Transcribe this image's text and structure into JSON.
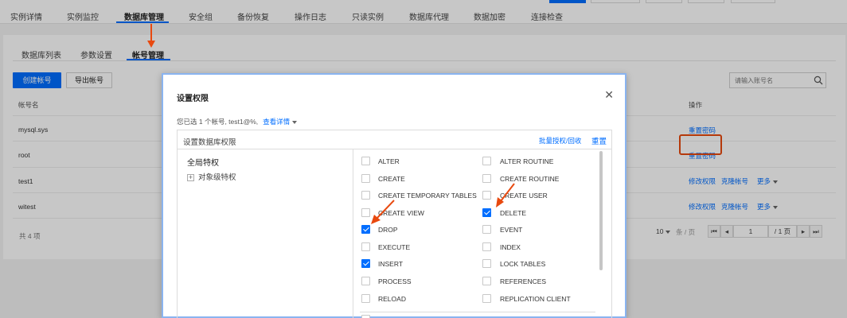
{
  "top_tabs": [
    "实例详情",
    "实例监控",
    "数据库管理",
    "安全组",
    "备份恢复",
    "操作日志",
    "只读实例",
    "数据库代理",
    "数据加密",
    "连接检查"
  ],
  "top_active_index": 2,
  "sub_tabs": [
    "数据库列表",
    "参数设置",
    "帐号管理"
  ],
  "sub_active_index": 2,
  "toolbar": {
    "create_label": "创建帐号",
    "export_label": "导出帐号",
    "search_placeholder": "请输入账号名"
  },
  "table": {
    "col_account": "帐号名",
    "col_actions": "操作",
    "rows": [
      {
        "name": "mysql.sys",
        "actions": [
          "重置密码"
        ]
      },
      {
        "name": "root",
        "actions": [
          "重置密码"
        ]
      },
      {
        "name": "test1",
        "actions": [
          "修改权限",
          "克隆帐号",
          "更多"
        ]
      },
      {
        "name": "witest",
        "actions": [
          "修改权限",
          "克隆帐号",
          "更多"
        ]
      }
    ],
    "total": "共 4 项"
  },
  "pagination": {
    "page_size": "10",
    "per_page_unit": "条 / 页",
    "current_page": "1",
    "total_pages": "/ 1 页"
  },
  "modal": {
    "title": "设置权限",
    "selected_info": "您已选 1 个帐号, test1@%,",
    "view_detail": "查看详情",
    "perm_box_title": "设置数据库权限",
    "batch_action": "批量授权/回收",
    "reset": "重置",
    "global_priv": "全局特权",
    "object_priv": "对象级特权",
    "privileges_left": [
      {
        "label": "ALTER",
        "checked": false
      },
      {
        "label": "CREATE",
        "checked": false
      },
      {
        "label": "CREATE TEMPORARY TABLES",
        "checked": false
      },
      {
        "label": "CREATE VIEW",
        "checked": false
      },
      {
        "label": "DROP",
        "checked": true
      },
      {
        "label": "EXECUTE",
        "checked": false
      },
      {
        "label": "INSERT",
        "checked": true
      },
      {
        "label": "PROCESS",
        "checked": false
      },
      {
        "label": "RELOAD",
        "checked": false
      }
    ],
    "privileges_right": [
      {
        "label": "ALTER ROUTINE",
        "checked": false
      },
      {
        "label": "CREATE ROUTINE",
        "checked": false
      },
      {
        "label": "CREATE USER",
        "checked": false
      },
      {
        "label": "DELETE",
        "checked": true
      },
      {
        "label": "EVENT",
        "checked": false
      },
      {
        "label": "INDEX",
        "checked": false
      },
      {
        "label": "LOCK TABLES",
        "checked": false
      },
      {
        "label": "REFERENCES",
        "checked": false
      },
      {
        "label": "REPLICATION CLIENT",
        "checked": false
      }
    ]
  },
  "colors": {
    "accent": "#006eff",
    "annotation": "#e8490f"
  },
  "icons": [
    "search-icon",
    "close-icon",
    "chevron-down-icon",
    "plus-icon",
    "first-page-icon",
    "prev-page-icon",
    "next-page-icon",
    "last-page-icon"
  ]
}
